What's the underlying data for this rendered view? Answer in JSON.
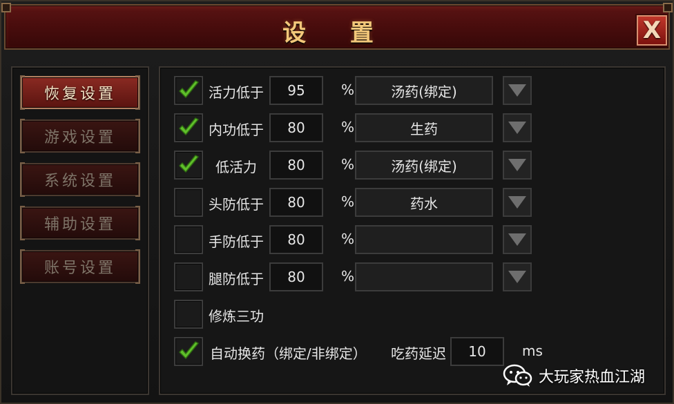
{
  "window": {
    "title": "设 置",
    "close_label": "X"
  },
  "tabs": [
    {
      "label": "恢复设置",
      "active": true
    },
    {
      "label": "游戏设置",
      "active": false
    },
    {
      "label": "系统设置",
      "active": false
    },
    {
      "label": "辅助设置",
      "active": false
    },
    {
      "label": "账号设置",
      "active": false
    }
  ],
  "rows": [
    {
      "checked": true,
      "label": "活力低于",
      "value": "95",
      "unit": "%",
      "item": "汤药(绑定)"
    },
    {
      "checked": true,
      "label": "内功低于",
      "value": "80",
      "unit": "%",
      "item": "生药"
    },
    {
      "checked": true,
      "label": "低活力",
      "value": "80",
      "unit": "%",
      "item": "汤药(绑定)"
    },
    {
      "checked": false,
      "label": "头防低于",
      "value": "80",
      "unit": "%",
      "item": "药水"
    },
    {
      "checked": false,
      "label": "手防低于",
      "value": "80",
      "unit": "%",
      "item": ""
    },
    {
      "checked": false,
      "label": "腿防低于",
      "value": "80",
      "unit": "%",
      "item": ""
    }
  ],
  "extra_option": {
    "checked": false,
    "label": "修炼三功"
  },
  "auto_swap": {
    "checked": true,
    "label": "自动换药（绑定/非绑定）",
    "delay_label": "吃药延迟",
    "delay_value": "10",
    "delay_unit": "ms"
  },
  "watermark": {
    "text": "大玩家热血江湖",
    "icon": "wechat-icon"
  },
  "colors": {
    "check": "#5fbf2a",
    "title_text": "#f2c77a",
    "active_tab": "#8a2a22"
  }
}
